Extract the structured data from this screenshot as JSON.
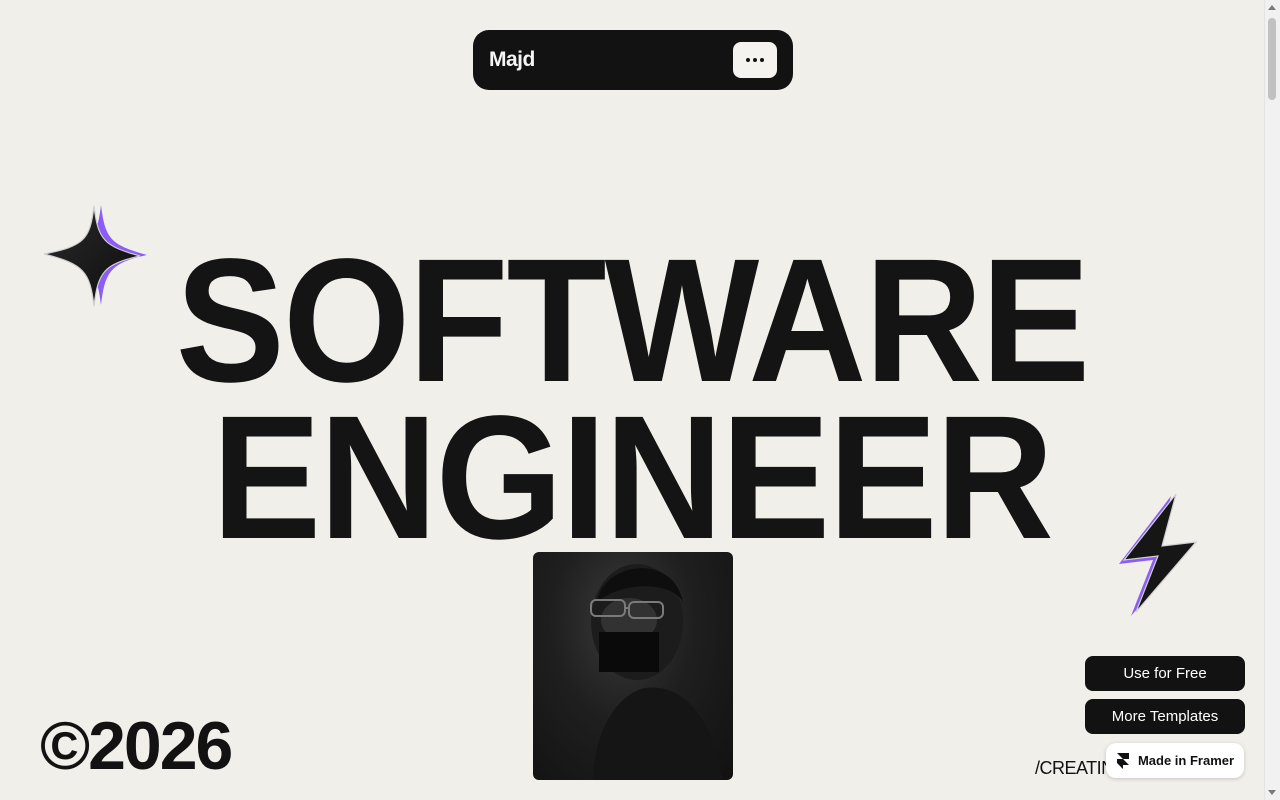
{
  "nav": {
    "brand": "Majd",
    "menu_icon": "more-dots-icon"
  },
  "hero": {
    "line1": "SOFTWARE",
    "line2": "ENGINEER"
  },
  "decor": {
    "sparkle_icon": "sparkle-star-icon",
    "bolt_icon": "lightning-bolt-icon",
    "accent_color": "#8b5cf6"
  },
  "portrait": {
    "icon": "portrait-photo"
  },
  "footer": {
    "copyright": "©2026",
    "tagline": "/CREATIN"
  },
  "cta": {
    "use_free": "Use for Free",
    "more_templates": "More Templates",
    "framer_badge": "Made in Framer"
  }
}
